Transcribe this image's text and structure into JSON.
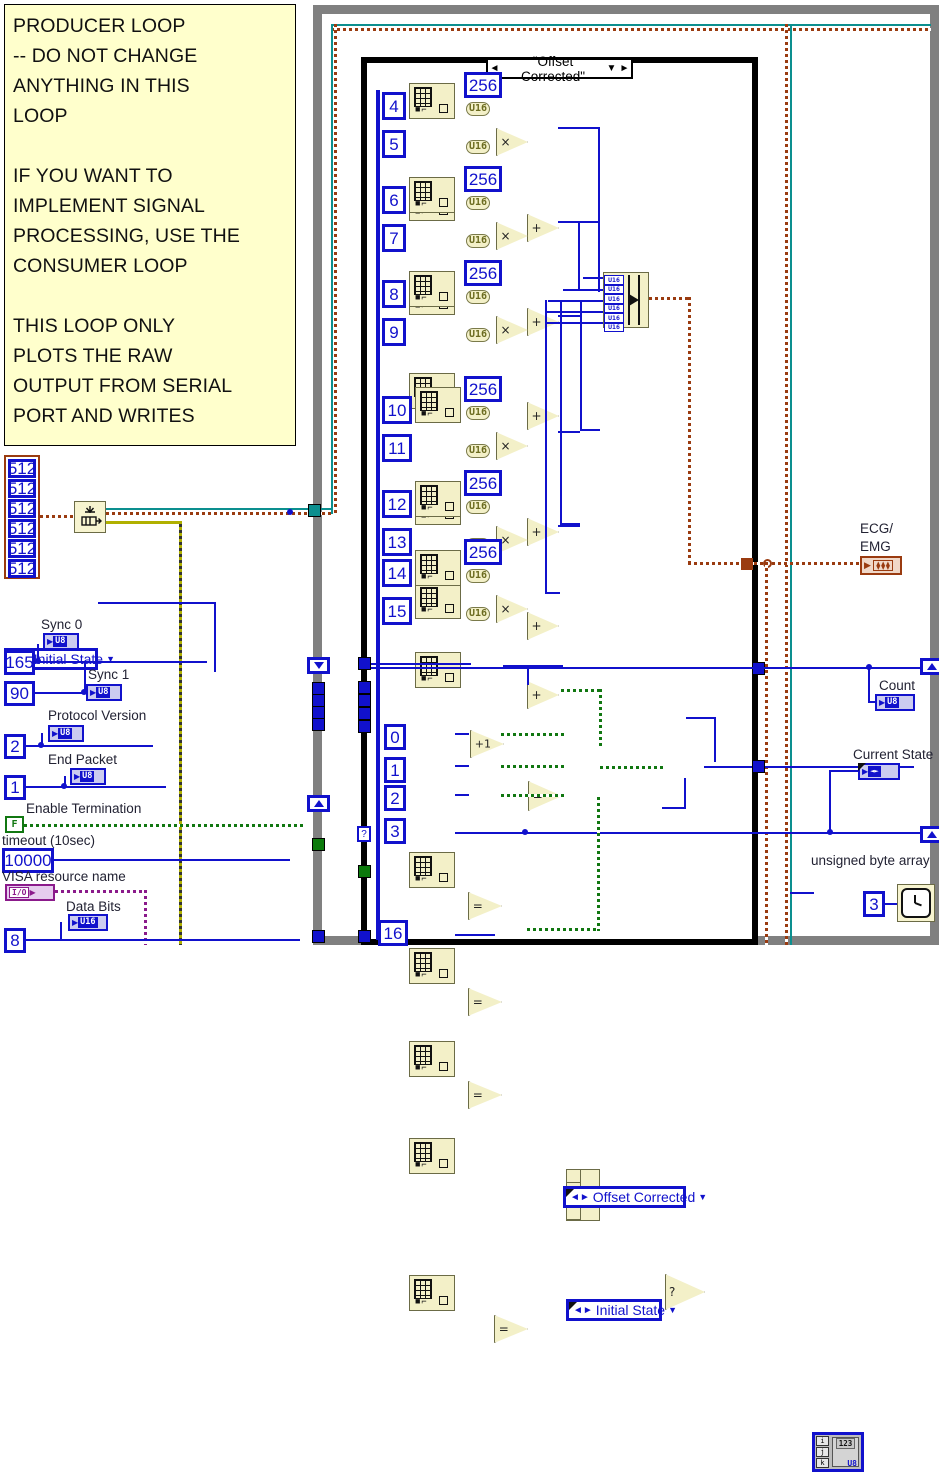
{
  "comment": {
    "text": "PRODUCER LOOP\n-- DO NOT CHANGE\nANYTHING IN THIS\nLOOP\n\nIF YOU WANT TO\nIMPLEMENT SIGNAL\nPROCESSING, USE THE\nCONSUMER LOOP\n\nTHIS LOOP ONLY\nPLOTS THE RAW\nOUTPUT FROM SERIAL\nPORT AND WRITES"
  },
  "case_structure": {
    "selector_label": "\"Offset Corrected\"",
    "left_arrow": "◄",
    "right_arrow": "►",
    "down_arrow": "▼"
  },
  "queue_array": {
    "label": "queue-size-array",
    "values": [
      "512",
      "512",
      "512",
      "512",
      "512",
      "512"
    ]
  },
  "channel_pairs": [
    {
      "hi": "4",
      "lo": "5",
      "mult": "256",
      "type_hi": "U16",
      "type_lo": "U16"
    },
    {
      "hi": "6",
      "lo": "7",
      "mult": "256",
      "type_hi": "U16",
      "type_lo": "U16"
    },
    {
      "hi": "8",
      "lo": "9",
      "mult": "256",
      "type_hi": "U16",
      "type_lo": "U16"
    },
    {
      "hi": "10",
      "lo": "11",
      "mult": "256",
      "type_hi": "U16",
      "type_lo": "U16"
    },
    {
      "hi": "12",
      "lo": "13",
      "mult": "256",
      "type_hi": "U16",
      "type_lo": "U16"
    },
    {
      "hi": "14",
      "lo": "15",
      "mult": "256",
      "type_hi": "U16",
      "type_lo": "U16"
    }
  ],
  "operators": {
    "multiply": "×",
    "add": "+",
    "increment": "+1",
    "equal": "=",
    "and": "∧",
    "select": "?"
  },
  "build_array": {
    "element_type": "U16",
    "element_count": 6
  },
  "lower_index_constants": [
    "0",
    "1",
    "2",
    "3",
    "16"
  ],
  "enum_constants": {
    "offset_corrected": "Offset Corrected",
    "initial_state": "Initial State"
  },
  "left_controls": {
    "state_enum": "Initial State",
    "items": [
      {
        "label": "Sync 0",
        "type": "U8",
        "value": "165"
      },
      {
        "label": "Sync 1",
        "type": "U8",
        "value": "90"
      },
      {
        "label": "Protocol Version",
        "type": "U8",
        "value": "2"
      },
      {
        "label": "End Packet",
        "type": "U8",
        "value": "1"
      }
    ],
    "enable_termination": {
      "label": "Enable Termination",
      "value": "F"
    },
    "timeout": {
      "label": "timeout (10sec)",
      "value": "10000"
    },
    "visa": {
      "label": "VISA resource name",
      "type": "I/O"
    },
    "data_bits": {
      "label": "Data Bits",
      "type": "U16",
      "value": "8"
    }
  },
  "right_indicators": {
    "ecg_emq": {
      "label_line1": "ECG/",
      "label_line2": "EMG",
      "type": "⧫⧫⧫"
    },
    "count": {
      "label": "Count",
      "type": "U8"
    },
    "current_state": {
      "label": "Current State",
      "type": "◄►"
    },
    "byte_array": {
      "label": "unsigned byte array",
      "type": "U8",
      "index_i": "i",
      "index_j": "j",
      "index_k": "k",
      "digits": "123"
    }
  },
  "timer": {
    "constant": "3",
    "icon": "wait-ms-icon"
  },
  "colors": {
    "wire_blue": "#1111cc",
    "wire_queue": "#9a3b10",
    "wire_teal": "#0c8f8f",
    "wire_green": "#117711",
    "node_fill": "#f3f0c8",
    "comment_bg": "#ffffcc",
    "loop_border": "#808080"
  }
}
